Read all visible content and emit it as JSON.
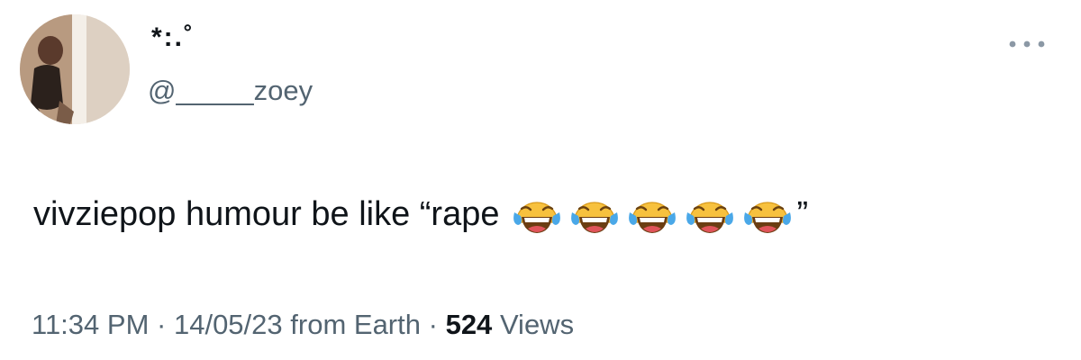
{
  "user": {
    "display_name": "*:.˚",
    "handle": "@_____zoey"
  },
  "more_icon": "more-horizontal-icon",
  "tweet": {
    "text": "vivziepop humour be like “rape",
    "emoji": "face-with-tears-of-joy",
    "emoji_count": 5,
    "closing_quote": "”"
  },
  "meta": {
    "time": "11:34 PM",
    "separator": "·",
    "date": "14/05/23",
    "source_prefix": "from",
    "source": "Earth",
    "views_count": "524",
    "views_label": "Views"
  },
  "colors": {
    "text_primary": "#0f1419",
    "text_secondary": "#536471",
    "emoji_face": "#f7c13e",
    "emoji_tears": "#4aa8e8"
  }
}
